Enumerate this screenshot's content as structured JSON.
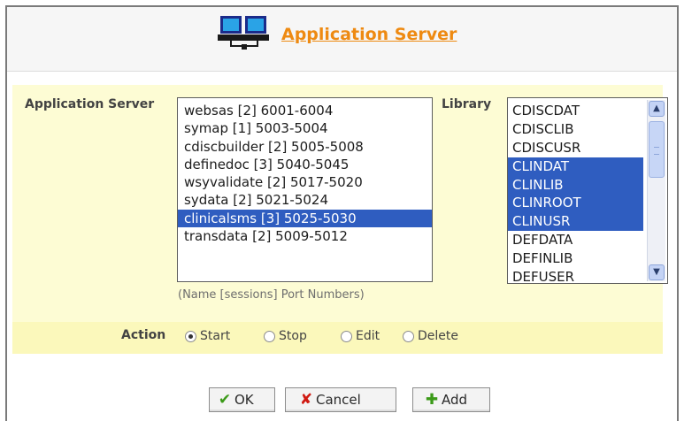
{
  "header": {
    "title": "Application Server"
  },
  "labels": {
    "application_server": "Application Server",
    "library": "Library",
    "hint": "(Name [sessions] Port Numbers)",
    "action": "Action"
  },
  "servers": [
    {
      "label": "websas [2] 6001-6004",
      "selected": false
    },
    {
      "label": "symap [1] 5003-5004",
      "selected": false
    },
    {
      "label": "cdiscbuilder [2] 5005-5008",
      "selected": false
    },
    {
      "label": "definedoc [3] 5040-5045",
      "selected": false
    },
    {
      "label": "wsyvalidate [2] 5017-5020",
      "selected": false
    },
    {
      "label": "sydata [2] 5021-5024",
      "selected": false
    },
    {
      "label": "clinicalsms [3] 5025-5030",
      "selected": true
    },
    {
      "label": "transdata [2] 5009-5012",
      "selected": false
    }
  ],
  "libraries": [
    {
      "label": "CDISCDAT",
      "selected": false
    },
    {
      "label": "CDISCLIB",
      "selected": false
    },
    {
      "label": "CDISCUSR",
      "selected": false
    },
    {
      "label": "CLINDAT",
      "selected": true
    },
    {
      "label": "CLINLIB",
      "selected": true
    },
    {
      "label": "CLINROOT",
      "selected": true
    },
    {
      "label": "CLINUSR",
      "selected": true
    },
    {
      "label": "DEFDATA",
      "selected": false
    },
    {
      "label": "DEFINLIB",
      "selected": false
    },
    {
      "label": "DEFUSER",
      "selected": false
    }
  ],
  "actions": {
    "start": "Start",
    "stop": "Stop",
    "edit": "Edit",
    "delete": "Delete",
    "selected": "start"
  },
  "buttons": {
    "ok": "OK",
    "cancel": "Cancel",
    "add": "Add"
  },
  "colors": {
    "title": "#ee8a12",
    "selection": "#2f5dc0",
    "panel": "#fdfcd4",
    "action_band": "#fbf8bb"
  },
  "icons": {
    "header": "server-icon",
    "ok": "checkmark-icon",
    "cancel": "x-icon",
    "add": "plus-icon"
  }
}
